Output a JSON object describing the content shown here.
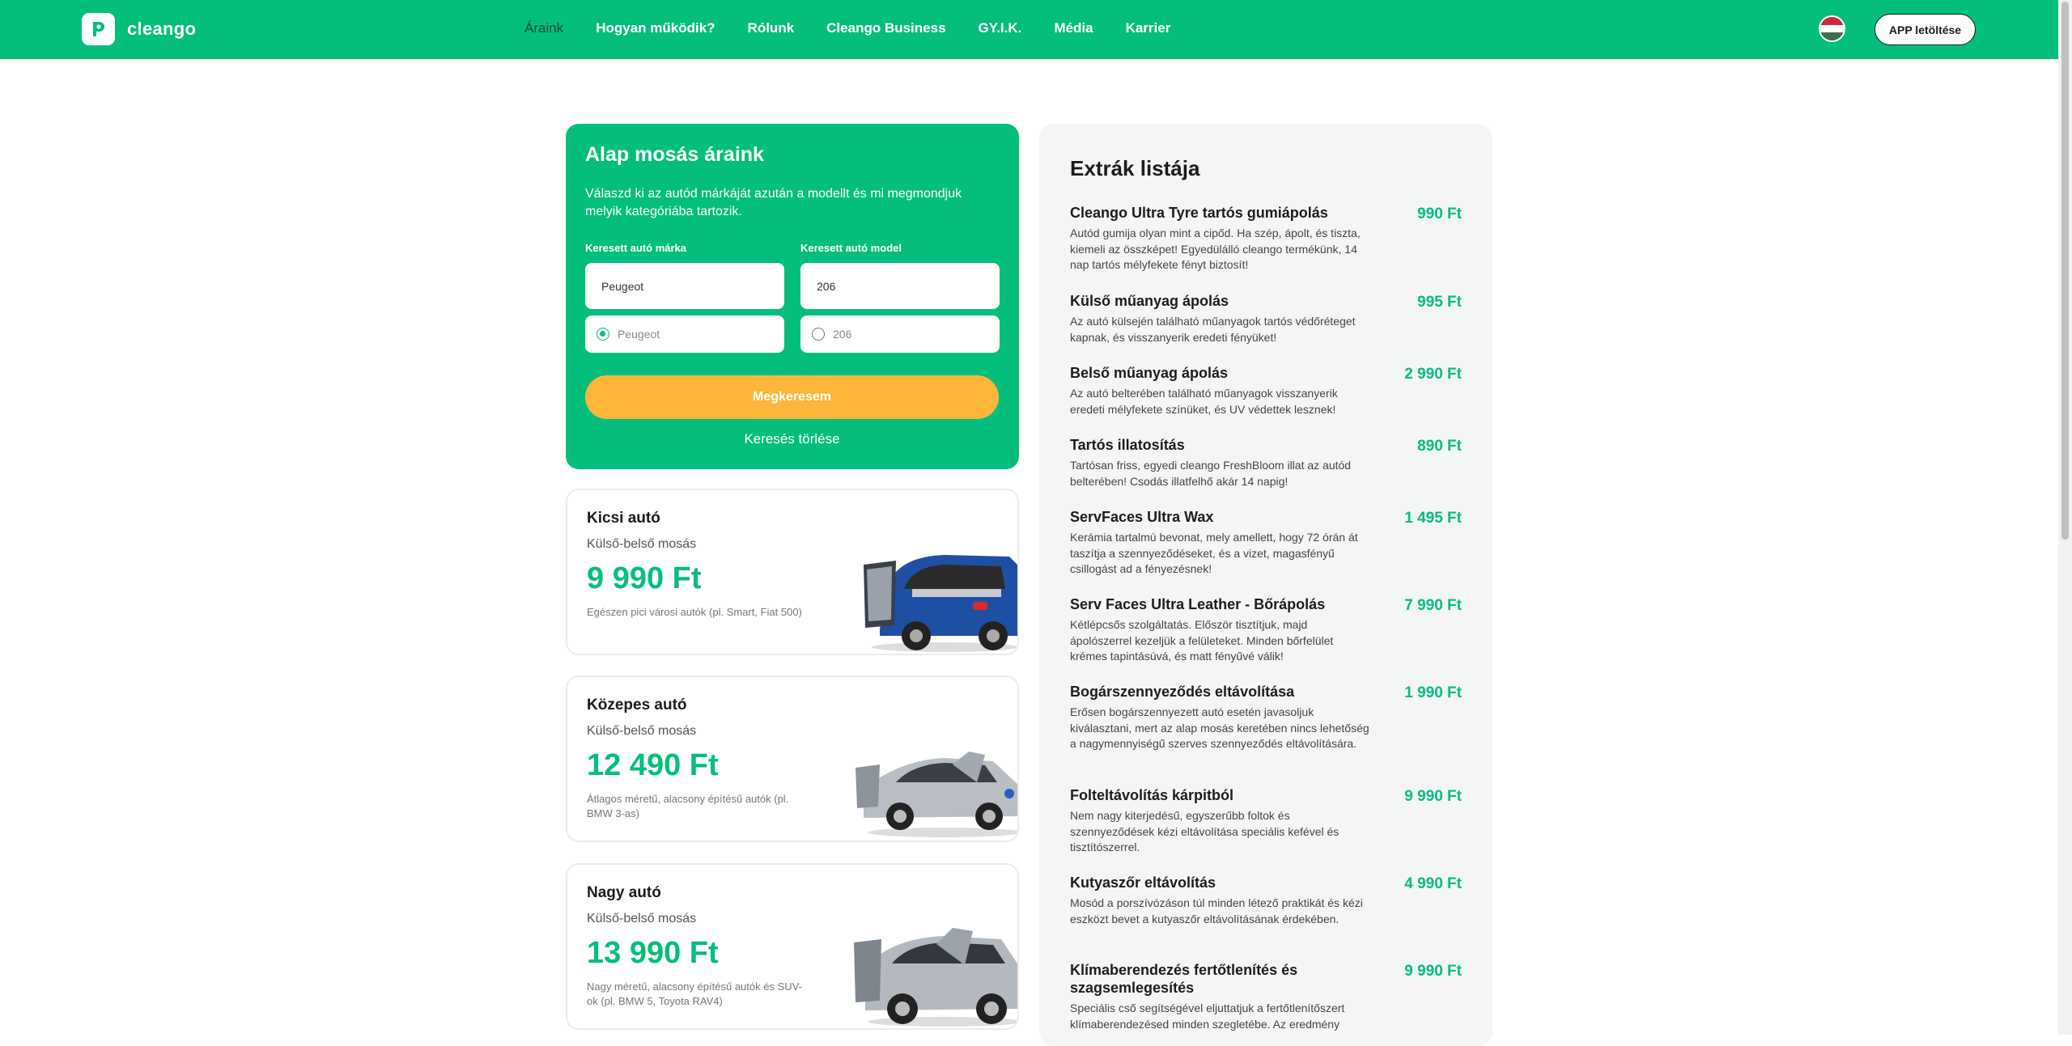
{
  "header": {
    "logo_text": "cleango",
    "nav": [
      "Áraink",
      "Hogyan működik?",
      "Rólunk",
      "Cleango Business",
      "GY.I.K.",
      "Média",
      "Karrier"
    ],
    "app_button": "APP letöltése",
    "flag_colors": [
      "#cd2a3e",
      "#ffffff",
      "#436f4d"
    ]
  },
  "search": {
    "title": "Alap mosás áraink",
    "description": "Válaszd ki az autód márkáját azután a modellt és mi megmondjuk melyik kategóriába tartozik.",
    "brand_label": "Keresett autó márka",
    "model_label": "Keresett autó model",
    "brand_value": "Peugeot",
    "model_value": "206",
    "brand_option": "Peugeot",
    "model_option": "206",
    "brand_option_selected": true,
    "model_option_selected": false,
    "search_button": "Megkeresem",
    "clear_link": "Keresés törlése"
  },
  "cars": [
    {
      "name": "Kicsi autó",
      "wash": "Külső-belső mosás",
      "price": "9 990 Ft",
      "desc": "Egészen pici városi autók (pl. Smart, Fiat 500)",
      "image": "small-car-blue"
    },
    {
      "name": "Közepes autó",
      "wash": "Külső-belső mosás",
      "price": "12 490 Ft",
      "desc": "Átlagos méretű, alacsony építésű autók (pl. BMW 3-as)",
      "image": "sedan-silver"
    },
    {
      "name": "Nagy autó",
      "wash": "Külső-belső mosás",
      "price": "13 990 Ft",
      "desc": "Nagy méretű, alacsony építésű autók és SUV-ok (pl. BMW 5, Toyota RAV4)",
      "image": "suv-silver"
    }
  ],
  "extras": {
    "title": "Extrák listája",
    "items": [
      {
        "name": "Cleango Ultra Tyre tartós gumiápolás",
        "price": "990 Ft",
        "desc": "Autód gumija olyan mint a cipőd. Ha szép, ápolt, és tiszta, kiemeli az összképet! Egyedülálló cleango termékünk, 14 nap tartós mélyfekete fényt biztosít!"
      },
      {
        "name": "Külső műanyag ápolás",
        "price": "995 Ft",
        "desc": "Az autó külsején található műanyagok tartós védőréteget kapnak, és visszanyerik eredeti fényüket!"
      },
      {
        "name": "Belső műanyag ápolás",
        "price": "2 990 Ft",
        "desc": "Az autó belterében található műanyagok visszanyerik eredeti mélyfekete színüket, és UV védettek lesznek!"
      },
      {
        "name": "Tartós illatosítás",
        "price": "890 Ft",
        "desc": "Tartósan friss, egyedi cleango FreshBloom illat az autód belterében! Csodás illatfelhő akár 14 napig!"
      },
      {
        "name": "ServFaces Ultra Wax",
        "price": "1 495 Ft",
        "desc": "Kerámia tartalmú bevonat, mely amellett, hogy 72 órán át taszítja a szennyeződéseket, és a vizet, magasfényű csillogást ad a fényezésnek!"
      },
      {
        "name": "Serv Faces Ultra Leather - Bőrápolás",
        "price": "7 990 Ft",
        "desc": "Kétlépcsős szolgáltatás. Először tisztítjuk, majd ápolószerrel kezeljük a felületeket. Minden bőrfelület krémes tapintásúvá, és matt fényűvé válik!"
      },
      {
        "name": "Bogárszennyeződés eltávolítása",
        "price": "1 990 Ft",
        "desc": "Erősen bogárszennyezett autó esetén javasoljuk kiválasztani, mert az alap mosás keretében nincs lehetőség a nagymennyiségű szerves szennyeződés eltávolítására."
      },
      {
        "name": "Folteltávolítás kárpitból",
        "price": "9 990 Ft",
        "desc": "Nem nagy kiterjedésű, egyszerűbb foltok és szennyeződések kézi eltávolítása speciális kefével és tisztítószerrel."
      },
      {
        "name": "Kutyaszőr eltávolítás",
        "price": "4 990 Ft",
        "desc": "Mosód a porszívózáson túl minden létező praktikát és kézi eszközt bevet a kutyaszőr eltávolításának érdekében."
      },
      {
        "name": "Klímaberendezés fertőtlenítés és szagsemlegesítés",
        "price": "9 990 Ft",
        "desc": "Speciális cső segítségével eljuttatjuk a fertőtlenítőszert klímaberendezésed minden szegletébe. Az eredmény"
      }
    ]
  }
}
